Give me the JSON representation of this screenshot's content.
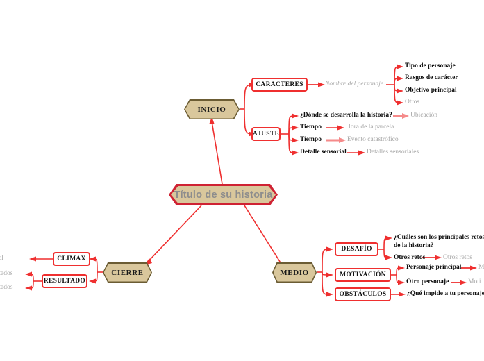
{
  "colors": {
    "connector_red": "#ef2f2f",
    "connector_pink": "#f58a8a",
    "node_fill_tan": "#d9c79c",
    "node_border_olive": "#6b5c33",
    "root_border_red": "#cf2233",
    "root_text_gray": "#8d8d8d",
    "leaf_muted_gray": "#a8a8a8",
    "box_border_red": "#ef2f2f",
    "box_fill_white": "#ffffff",
    "page_background": "#ffffff"
  },
  "root": {
    "label": "Título de su historia"
  },
  "branches": {
    "inicio": {
      "label": "INICIO",
      "children": [
        {
          "label": "CARACTERES",
          "detail": "Nombre del personaje",
          "leaves": [
            {
              "label": "Tipo de personaje",
              "style": "bold"
            },
            {
              "label": "Rasgos de carácter",
              "style": "bold"
            },
            {
              "label": "Objetivo principal",
              "style": "bold"
            },
            {
              "label": "Otros",
              "style": "muted"
            }
          ]
        },
        {
          "label": "AJUSTE",
          "leaves": [
            {
              "label": "¿Dónde se desarrolla la historia?",
              "style": "bold",
              "detail": "Ubicación"
            },
            {
              "label": "Tiempo",
              "style": "bold",
              "detail": "Hora de la parcela"
            },
            {
              "label": "Tiempo",
              "style": "bold",
              "detail": "Evento catastrófico"
            },
            {
              "label": "Detalle sensorial",
              "style": "bold",
              "detail": "Detalles sensoriales"
            }
          ]
        }
      ]
    },
    "medio": {
      "label": "MEDIO",
      "children": [
        {
          "label": "DESAFÍO",
          "leaves": [
            {
              "label": "¿Cuáles son los principales retos de la historia?",
              "style": "bold"
            },
            {
              "label": "Otros retos",
              "style": "bold",
              "detail": "Otros retos"
            }
          ]
        },
        {
          "label": "MOTIVACIÓN",
          "leaves": [
            {
              "label": "Personaje principal",
              "style": "bold",
              "detail": "M"
            },
            {
              "label": "Otro personaje",
              "style": "bold",
              "detail": "Moti"
            }
          ]
        },
        {
          "label": "OBSTÁCULOS",
          "leaves": [
            {
              "label": "¿Qué impide a tu personaje",
              "style": "bold"
            }
          ]
        }
      ]
    },
    "cierre": {
      "label": "CIERRE",
      "children": [
        {
          "label": "CLIMAX",
          "leaves": [
            {
              "label": "el",
              "style": "muted"
            }
          ]
        },
        {
          "label": "RESULTADO",
          "leaves": [
            {
              "label": "ultados",
              "style": "muted"
            },
            {
              "label": "ultados",
              "style": "muted"
            }
          ]
        }
      ]
    }
  }
}
